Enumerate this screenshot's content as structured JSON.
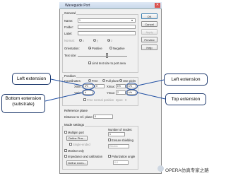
{
  "window": {
    "title": "Waveguide Port",
    "close_glyph": "✕"
  },
  "general": {
    "group_label": "General",
    "name_label": "Name:",
    "name_value": "1",
    "folder_label": "Folder:",
    "folder_value": "",
    "label_label": "Label:",
    "label_value": "",
    "normal_label": "Normal:",
    "normal_options": [
      "x",
      "y",
      "z"
    ],
    "orientation_label": "Orientation:",
    "orientation_positive": "Positive",
    "orientation_negative": "Negative",
    "textsize_label": "Text size:",
    "limit_text_label": "Limit text size to port area"
  },
  "buttons": {
    "ok": "OK",
    "cancel": "Cancel",
    "apply": "Apply",
    "preview": "Preview",
    "help": "Help"
  },
  "position": {
    "group_label": "Position",
    "coordinates_label": "Coordinates:",
    "coord_free": "Free",
    "coord_full_plane": "Full plane",
    "coord_use_picks": "Use picks",
    "xmin_label": "Xmin:",
    "xmin_value": "k*h",
    "xmax_label": "Xmax:",
    "xmax_value": "k*h",
    "ymin_label": "Ymin:",
    "ymin_value": "h",
    "ymax_label": "Ymax:",
    "ymax_value": "2",
    "free_normal_label": "Free normal position",
    "zpos_label": "Zpos:",
    "zpos_value": "0",
    "extra_left": "0",
    "extra_right": "k*h"
  },
  "reference_plane": {
    "group_label": "Reference plane",
    "distance_label": "Distance to ref. plane:",
    "distance_value": "0"
  },
  "mode_settings": {
    "group_label": "Mode settings",
    "multipin_label": "Multipin port",
    "define_pins_label": "Define Pins...",
    "single_ended_label": "Single-ended",
    "monitor_only_label": "Monitor only",
    "impedance_label": "Impedance and calibration",
    "define_lines_label": "Define Lines...",
    "num_modes_label": "Number of modes:",
    "num_modes_value": "1",
    "ensure_shielding_label": "Ensure shielding",
    "electric_value": "Electric",
    "polarization_label": "Polarization angle",
    "polarization_value": "0.0"
  },
  "annotations": {
    "left_extension_1": "Left extension",
    "bottom_extension": "Bottom extension (substrate)",
    "left_extension_2": "Left extension",
    "top_extension": "Top extension",
    "annotation_color": "#1f4ea3"
  },
  "watermark": {
    "text": "OPERA仿真专家之路"
  }
}
